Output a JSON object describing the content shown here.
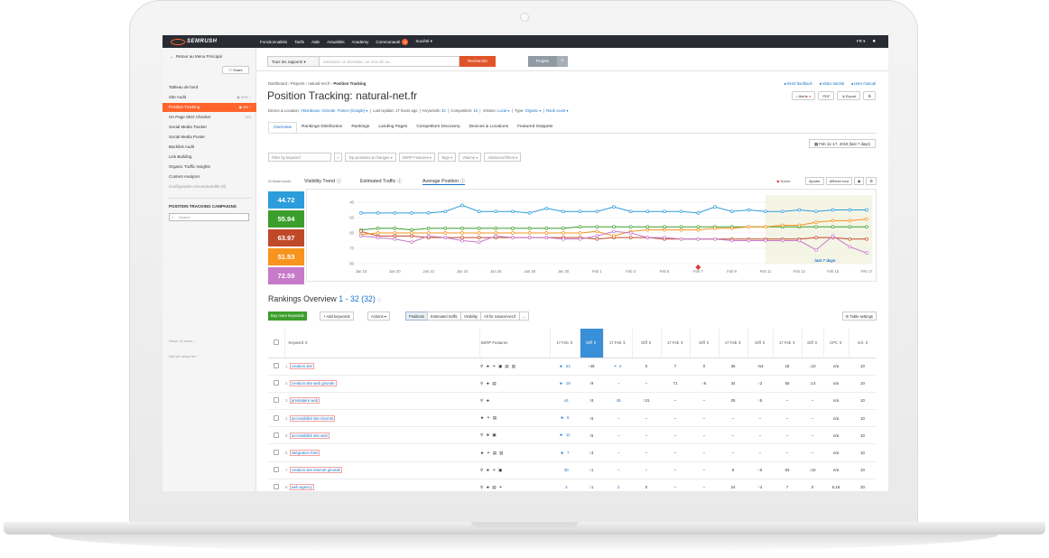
{
  "topbar": {
    "logo": "SEMRUSH",
    "nav": [
      "Fonctionnalités",
      "Tarifs",
      "Aide",
      "Actualités",
      "Academy",
      "Communauté",
      "Société"
    ],
    "community_badge": "5",
    "lang": "FR"
  },
  "sidebar": {
    "back": "Retour au Menu Principal",
    "share": "Share",
    "items": [
      {
        "label": "Tableau de bord",
        "meta": ""
      },
      {
        "label": "Site Audit",
        "meta": "90%"
      },
      {
        "label": "Position Tracking",
        "meta": "0%"
      },
      {
        "label": "On Page SEO Checker",
        "meta": "224"
      },
      {
        "label": "Social Media Tracker",
        "meta": ""
      },
      {
        "label": "Social Media Poster",
        "meta": ""
      },
      {
        "label": "Backlink Audit",
        "meta": ""
      },
      {
        "label": "Link Building",
        "meta": ""
      },
      {
        "label": "Organic Traffic Insights",
        "meta": ""
      },
      {
        "label": "Content Analyzer",
        "meta": ""
      },
      {
        "label": "Configuration recommandée (0)",
        "meta": ""
      }
    ],
    "campaigns_heading": "POSITION TRACKING CAMPAIGNS",
    "search_placeholder": "Search",
    "show_more": "Show 10 more...",
    "not_setup": "Not yet setup for"
  },
  "searchbar": {
    "select": "Tous les rapports",
    "placeholder": "Saisissez un domaine, un mot clé ou...",
    "button": "Recherche",
    "projects": "Projets",
    "plus": "+"
  },
  "header": {
    "breadcrumb": [
      "Dashboard",
      "Projects",
      "natural-net.fr",
      "Position Tracking"
    ],
    "links": [
      "Send feedback",
      "Video tutorial",
      "User manual"
    ],
    "title": "Position Tracking:",
    "domain": "natural-net.fr",
    "actions": [
      "Alerts",
      "PDF",
      "Export"
    ],
    "meta": {
      "device_label": "Device & Location:",
      "device_value": "Bordeaux, Gironde, France (Google)",
      "last_update": "Last Update: 17 hours ago",
      "keywords_label": "Keywords:",
      "keywords": "32",
      "competitors_label": "Competitors:",
      "competitors": "16",
      "volume_label": "Volume:",
      "volume": "Local",
      "type_label": "Type:",
      "type": "Organic",
      "rank_count": "Rank count"
    }
  },
  "tabs": [
    "Overview",
    "Rankings Distribution",
    "Rankings",
    "Landing Pages",
    "Competitors Discovery",
    "Devices & Locations",
    "Featured Snippets"
  ],
  "date_range": "Feb 11–17, 2019 (last 7 days)",
  "filters": [
    "Filter by keyword",
    "Top positions & changes",
    "SERP Features",
    "Tags",
    "Volume",
    "Advanced filters"
  ],
  "chart_header": {
    "smart_zoom": "Smart zoom",
    "tabs": [
      "Visibility Trend",
      "Estimated Traffic",
      "Average Position"
    ],
    "notes": "Notes:",
    "add": "Ajouter",
    "show_all": "Afficher tout"
  },
  "kpis": [
    {
      "value": "44.72",
      "color": "#2d9cdb"
    },
    {
      "value": "55.94",
      "color": "#3c9e2c"
    },
    {
      "value": "63.97",
      "color": "#c0492a"
    },
    {
      "value": "51.53",
      "color": "#f7941d"
    },
    {
      "value": "72.59",
      "color": "#c77ac9"
    }
  ],
  "chart_data": {
    "type": "line",
    "x": [
      "Jan 18",
      "Jan 19",
      "Jan 20",
      "Jan 21",
      "Jan 22",
      "Jan 23",
      "Jan 24",
      "Jan 25",
      "Jan 26",
      "Jan 27",
      "Jan 28",
      "Jan 29",
      "Jan 30",
      "Jan 31",
      "Feb 1",
      "Feb 2",
      "Feb 3",
      "Feb 4",
      "Feb 5",
      "Feb 6",
      "Feb 7",
      "Feb 8",
      "Feb 9",
      "Feb 10",
      "Feb 11",
      "Feb 12",
      "Feb 13",
      "Feb 14",
      "Feb 15",
      "Feb 16",
      "Feb 17"
    ],
    "x_tick_labels": [
      "Jan 18",
      "Jan 20",
      "Jan 22",
      "Jan 24",
      "Jan 26",
      "Jan 28",
      "Jan 30",
      "Feb 1",
      "Feb 3",
      "Feb 5",
      "Feb 7",
      "Feb 9",
      "Feb 11",
      "Feb 13",
      "Feb 15",
      "Feb 17"
    ],
    "y_ticks": [
      40,
      50,
      60,
      70,
      80
    ],
    "ylim": [
      40,
      80
    ],
    "y_reversed": true,
    "highlight_label": "last 7 days",
    "highlight_from": "Feb 11",
    "series": [
      {
        "color": "#2d9cdb",
        "values": [
          47,
          47,
          47,
          47,
          47,
          46,
          42,
          46,
          46,
          46,
          47,
          44,
          46,
          46,
          46,
          43,
          46,
          46,
          46,
          46,
          47,
          43,
          46,
          45,
          46,
          46,
          45,
          46,
          45,
          45,
          45
        ]
      },
      {
        "color": "#3c9e2c",
        "values": [
          58,
          57,
          57,
          58,
          57,
          57,
          57,
          57,
          57,
          57,
          57,
          57,
          57,
          56,
          56,
          56,
          56,
          56,
          56,
          56,
          56,
          56,
          56,
          56,
          56,
          56,
          56,
          56,
          56,
          56,
          56
        ]
      },
      {
        "color": "#c0492a",
        "values": [
          59,
          62,
          62,
          62,
          63,
          63,
          63,
          63,
          63,
          63,
          63,
          63,
          63,
          63,
          64,
          63,
          63,
          63,
          64,
          64,
          64,
          64,
          64,
          64,
          64,
          64,
          64,
          63,
          63,
          64,
          64
        ]
      },
      {
        "color": "#f7941d",
        "values": [
          61,
          60,
          60,
          60,
          60,
          60,
          60,
          60,
          60,
          60,
          60,
          60,
          60,
          60,
          59,
          62,
          59,
          58,
          58,
          58,
          58,
          57,
          57,
          56,
          56,
          55,
          55,
          53,
          52,
          52,
          51
        ]
      },
      {
        "color": "#c77ac9",
        "values": [
          62,
          63,
          64,
          66,
          62,
          63,
          65,
          66,
          62,
          63,
          63,
          63,
          64,
          64,
          62,
          59,
          60,
          63,
          63,
          64,
          64,
          64,
          65,
          65,
          65,
          65,
          65,
          71,
          62,
          69,
          73
        ]
      }
    ],
    "note_marker_x": "Feb 7"
  },
  "rankings": {
    "title": "Rankings Overview",
    "range": "1 - 32",
    "count": "(32)",
    "buy_button": "Buy more keywords",
    "add_keywords": "Add keywords",
    "actions": "Actions",
    "segments": [
      "Positions",
      "Estimated traffic",
      "Visibility",
      "All for natural-net.fr",
      "..."
    ],
    "table_settings": "Table settings",
    "columns": [
      "Keyword",
      "SERP Features",
      "17 Feb",
      "Diff",
      "17 Feb",
      "Diff",
      "17 Feb",
      "Diff",
      "17 Feb",
      "Diff",
      "17 Feb",
      "Diff",
      "CPC",
      "Vol."
    ],
    "rows": [
      {
        "n": "1.",
        "kw": "creation site",
        "serp": "⚲ ★ ⚭ ▣ ▤ ▥",
        "s1": "★",
        "p1": "54",
        "d1": "↑46",
        "d1c": "green",
        "s2": "⚭",
        "p2": "4",
        "d2": "0",
        "d2c": "grey",
        "p3": "7",
        "d3": "0",
        "d3c": "grey",
        "p4": "35",
        "d4": "↑64",
        "d4c": "green",
        "p5": "18",
        "d5": "↓10",
        "d5c": "red",
        "cpc": "n/a",
        "vol": "10"
      },
      {
        "n": "2.",
        "kw": "creation site web gironde",
        "serp": "⚲ ★ ▤",
        "s1": "★",
        "p1": "19",
        "d1": "↑9",
        "d1c": "green",
        "s2": "",
        "p2": "–",
        "d2": "–",
        "d2c": "grey",
        "p3": "71",
        "d3": "↑6",
        "d3c": "green",
        "p4": "34",
        "d4": "↑2",
        "d4c": "green",
        "p5": "55",
        "d5": "↓14",
        "d5c": "red",
        "cpc": "n/a",
        "vol": "10"
      },
      {
        "n": "3.",
        "kw": "prestataire web",
        "serp": "⚲ ★",
        "s1": "",
        "p1": "44",
        "d1": "↑8",
        "d1c": "green",
        "s2": "",
        "p2": "45",
        "d2": "↑31",
        "d2c": "green",
        "p3": "–",
        "d3": "–",
        "d3c": "grey",
        "p4": "25",
        "d4": "↑5",
        "d4c": "green",
        "p5": "–",
        "d5": "–",
        "d5c": "grey",
        "cpc": "n/a",
        "vol": "10"
      },
      {
        "n": "4.",
        "kw": "accessibilité site internet",
        "serp": "★ ⚭ ▤",
        "s1": "★",
        "p1": "6",
        "d1": "↑6",
        "d1c": "green",
        "s2": "",
        "p2": "–",
        "d2": "–",
        "d2c": "grey",
        "p3": "–",
        "d3": "–",
        "d3c": "grey",
        "p4": "–",
        "d4": "–",
        "d4c": "grey",
        "p5": "–",
        "d5": "–",
        "d5c": "grey",
        "cpc": "n/a",
        "vol": "10"
      },
      {
        "n": "5.",
        "kw": "accessibilité site web",
        "serp": "⚲ ★ ▣",
        "s1": "★",
        "p1": "11",
        "d1": "↑5",
        "d1c": "green",
        "s2": "",
        "p2": "–",
        "d2": "–",
        "d2c": "grey",
        "p3": "–",
        "d3": "–",
        "d3c": "grey",
        "p4": "–",
        "d4": "–",
        "d4c": "grey",
        "p5": "–",
        "d5": "–",
        "d5c": "grey",
        "cpc": "n/a",
        "vol": "10"
      },
      {
        "n": "6.",
        "kw": "intégration html",
        "serp": "★ ⚭ ▤ ▥",
        "s1": "★",
        "p1": "7",
        "d1": "↑3",
        "d1c": "green",
        "s2": "",
        "p2": "–",
        "d2": "–",
        "d2c": "grey",
        "p3": "–",
        "d3": "–",
        "d3c": "grey",
        "p4": "–",
        "d4": "–",
        "d4c": "grey",
        "p5": "–",
        "d5": "–",
        "d5c": "grey",
        "cpc": "n/a",
        "vol": "10"
      },
      {
        "n": "7.",
        "kw": "creation site internet gironde",
        "serp": "⚲ ★ ⚭ ▣",
        "s1": "",
        "p1": "30",
        "d1": "↑1",
        "d1c": "green",
        "s2": "",
        "p2": "–",
        "d2": "–",
        "d2c": "grey",
        "p3": "–",
        "d3": "–",
        "d3c": "grey",
        "p4": "9",
        "d4": "↑6",
        "d4c": "green",
        "p5": "53",
        "d5": "↓15",
        "d5c": "red",
        "cpc": "n/a",
        "vol": "10"
      },
      {
        "n": "8.",
        "kw": "web agency",
        "serp": "⚲ ★ ▤ ⚭",
        "s1": "",
        "p1": "3",
        "d1": "↑1",
        "d1c": "green",
        "s2": "",
        "p2": "2",
        "d2": "0",
        "d2c": "grey",
        "p3": "–",
        "d3": "–",
        "d3c": "grey",
        "p4": "24",
        "d4": "↑4",
        "d4c": "green",
        "p5": "7",
        "d5": "0",
        "d5c": "grey",
        "cpc": "5.18",
        "vol": "20"
      }
    ]
  }
}
